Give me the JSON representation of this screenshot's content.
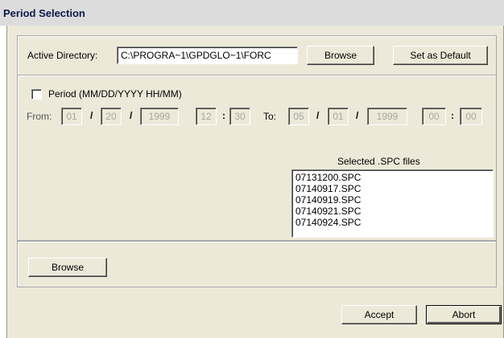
{
  "window": {
    "title": "Period Selection"
  },
  "directory": {
    "label": "Active Directory:",
    "value": "C:\\PROGRA~1\\GPDGLO~1\\FORC",
    "browse_label": "Browse",
    "set_default_label": "Set as Default"
  },
  "period": {
    "checkbox_label": "Period (MM/DD/YYYY HH/MM)",
    "checked": false,
    "from_label": "From:",
    "to_label": "To:",
    "date_sep": "/",
    "time_sep": ":",
    "from": {
      "month": "01",
      "day": "20",
      "year": "1999",
      "hour": "12",
      "minute": "30"
    },
    "to": {
      "month": "05",
      "day": "01",
      "year": "1999",
      "hour": "00",
      "minute": "00"
    }
  },
  "files": {
    "header": "Selected .SPC files",
    "items": [
      "07131200.SPC",
      "07140917.SPC",
      "07140919.SPC",
      "07140921.SPC",
      "07140924.SPC"
    ]
  },
  "bottom": {
    "browse_label": "Browse"
  },
  "footer": {
    "accept_label": "Accept",
    "abort_label": "Abort"
  }
}
